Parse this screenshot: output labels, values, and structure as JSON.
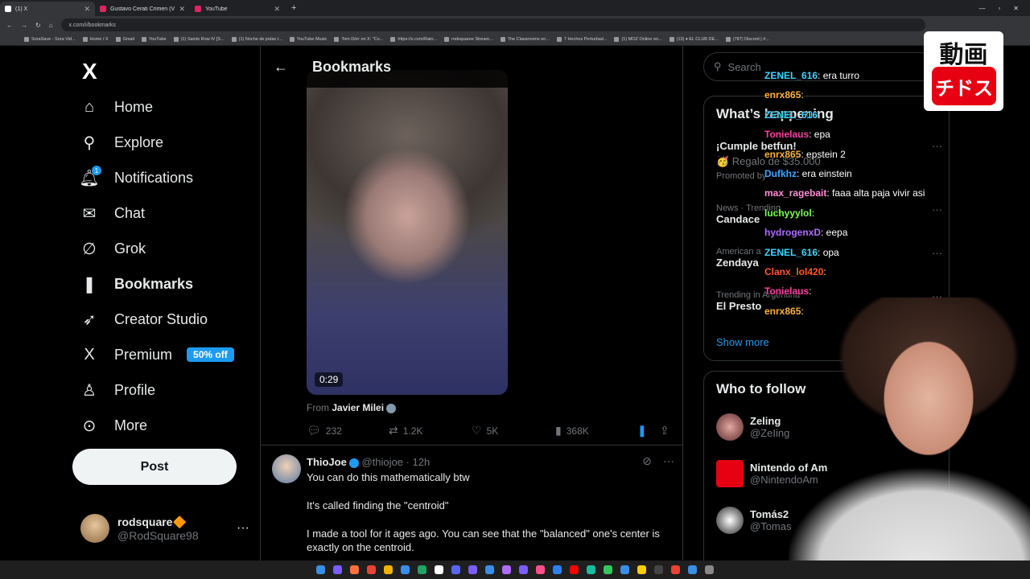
{
  "browser": {
    "tabs": [
      {
        "title": "(1) X",
        "favicon": "x-favicon",
        "active": true
      },
      {
        "title": "Gustavo Cerati Crimen (Vers Co",
        "favicon": "youtube-favicon",
        "active": false
      },
      {
        "title": "YouTube",
        "favicon": "youtube-favicon",
        "active": false
      }
    ],
    "new_tab": "+",
    "url": "x.com/i/bookmarks",
    "bookmarks": [
      "SoraSave - Sora Vid...",
      "Home / X",
      "Gmail",
      "YouTube",
      "(1) Saints Row IV [S...",
      "(1) Noche de jodas t...",
      "YouTube Music",
      "Tom Dörr on X: \"Co...",
      "https://x.com/Rain...",
      "rodsquaree Stream...",
      "The Classrooms en...",
      "7 Hechos Perturbad...",
      "(1) MOZ Online on...",
      "(13) ♦ EL CLUB DE...",
      "(787) Discord | #..."
    ]
  },
  "nav": {
    "logo": "X",
    "items": [
      {
        "label": "Home",
        "icon": "home-icon",
        "glyph": "⌂"
      },
      {
        "label": "Explore",
        "icon": "search-icon",
        "glyph": "⚲"
      },
      {
        "label": "Notifications",
        "icon": "bell-icon",
        "glyph": "🔔︎",
        "badge": "1"
      },
      {
        "label": "Chat",
        "icon": "mail-icon",
        "glyph": "✉"
      },
      {
        "label": "Grok",
        "icon": "grok-icon",
        "glyph": "∅"
      },
      {
        "label": "Bookmarks",
        "icon": "bookmark-icon",
        "glyph": "❚",
        "active": true
      },
      {
        "label": "Creator Studio",
        "icon": "rocket-icon",
        "glyph": "➶"
      },
      {
        "label": "Premium",
        "icon": "x-icon",
        "glyph": "X",
        "promo": "50% off"
      },
      {
        "label": "Profile",
        "icon": "person-icon",
        "glyph": "♙"
      },
      {
        "label": "More",
        "icon": "more-circle-icon",
        "glyph": "⊙"
      }
    ],
    "post_button": "Post",
    "account": {
      "name": "rodsquare🔶",
      "handle": "@RodSquare98",
      "more": "···"
    }
  },
  "main": {
    "header_title": "Bookmarks",
    "video_duration": "0:29",
    "from_label": "From",
    "from_name": "Javier Milei",
    "actions": {
      "replies": "232",
      "reposts": "1.2K",
      "likes": "5K",
      "views": "368K"
    },
    "tweet2": {
      "name": "ThioJoe",
      "handle": "@thiojoe",
      "time": "· 12h",
      "lines": [
        "You can do this mathematically btw",
        "It's called finding the \"centroid\"",
        "I made a tool for it ages ago. You can see that the \"balanced\" one's center is exactly on the centroid."
      ]
    }
  },
  "right": {
    "search_placeholder": "Search",
    "trends_title": "What’s happening",
    "trends": [
      {
        "meta": "",
        "title": "¡Cumple betfun!",
        "sub": "🥳 Regalo de $35.000",
        "promoted": "Promoted by"
      },
      {
        "meta": "News · Trending",
        "title": "Candace",
        "sub": "",
        "promoted": ""
      },
      {
        "meta": "American a",
        "title": "Zendaya",
        "sub": "",
        "promoted": ""
      },
      {
        "meta": "Trending in Argentina",
        "title": "El Presto",
        "sub": "",
        "promoted": ""
      }
    ],
    "show_more": "Show more",
    "who_title": "Who to follow",
    "who": [
      {
        "name": "Zeling",
        "handle": "@ZeIing"
      },
      {
        "name": "Nintendo of Am",
        "handle": "@NintendoAm"
      },
      {
        "name": "Tomás2",
        "handle": "@Tomas"
      }
    ]
  },
  "chat": [
    {
      "user": "ZENEL_616",
      "msg": ": era turro",
      "color": "#3fd6ff"
    },
    {
      "user": "enrx865",
      "msg": ":",
      "color": "#ffb13b"
    },
    {
      "user": "ZENEL_616",
      "msg": ":",
      "color": "#3fd6ff"
    },
    {
      "user": "Tonielaus",
      "msg": ": epa",
      "color": "#ff3fa4"
    },
    {
      "user": "enrx865",
      "msg": ": epstein 2",
      "color": "#ffb13b"
    },
    {
      "user": "Dufkhz",
      "msg": ": era einstein",
      "color": "#3fa6ff"
    },
    {
      "user": "max_ragebait",
      "msg": ": faaa alta paja vivir asi",
      "color": "#ff8fd8"
    },
    {
      "user": "luchyyylol",
      "msg": ":",
      "color": "#7dff4a"
    },
    {
      "user": "hydrogenxD",
      "msg": ": eepa",
      "color": "#b06bff"
    },
    {
      "user": "ZENEL_616",
      "msg": ": opa",
      "color": "#3fd6ff"
    },
    {
      "user": "Clanx_lol420",
      "msg": ":",
      "color": "#ff5a2a"
    },
    {
      "user": "Tonielaus",
      "msg": ":",
      "color": "#ff3fa4"
    },
    {
      "user": "enrx865",
      "msg": ":",
      "color": "#ffb13b"
    }
  ],
  "overlay_logo": {
    "top": "動画",
    "bottom": "チドス"
  }
}
